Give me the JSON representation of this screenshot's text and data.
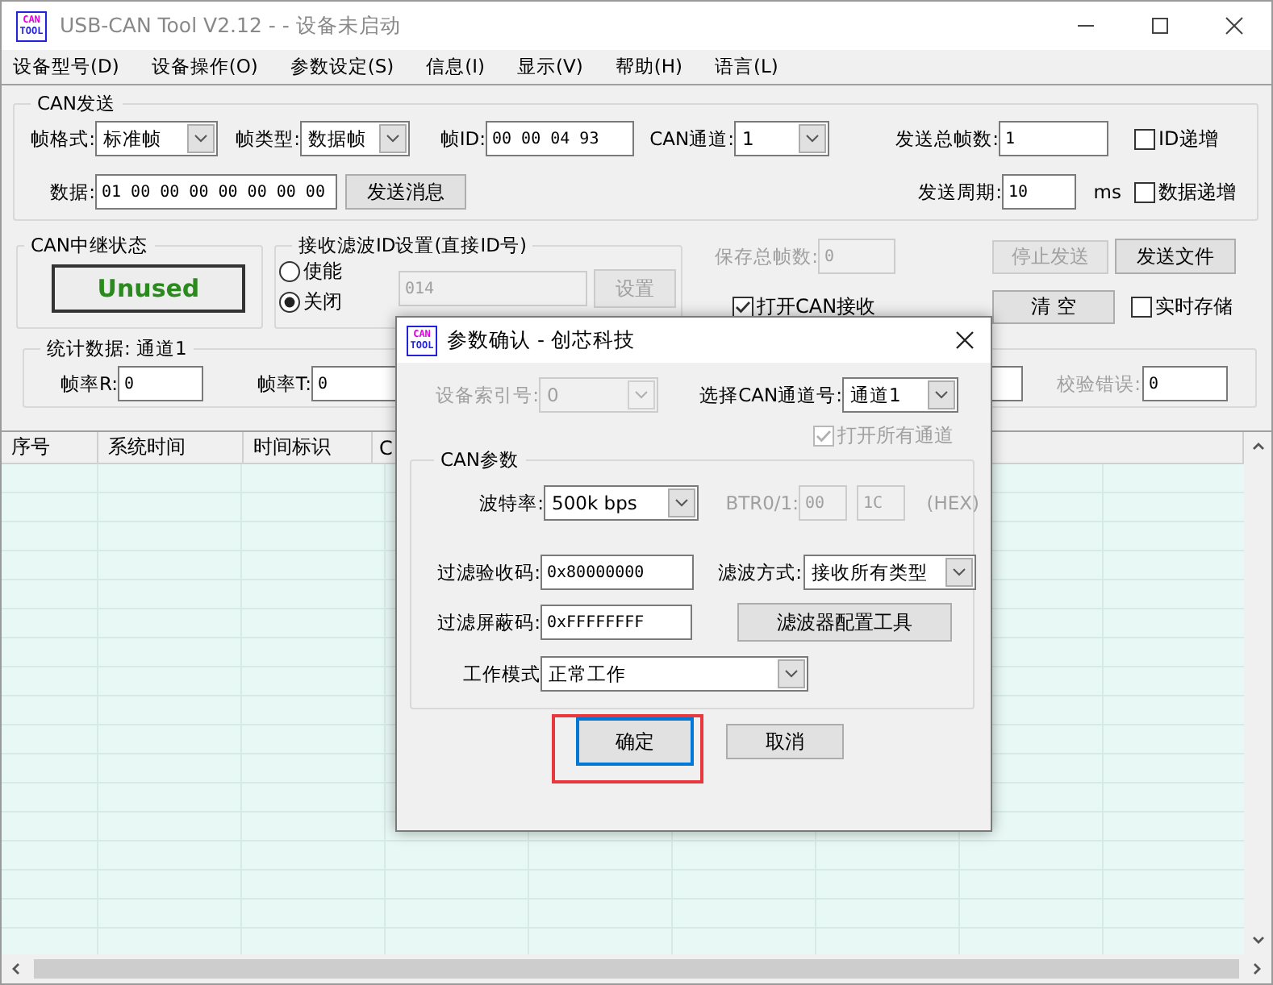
{
  "window": {
    "logo": [
      "CAN",
      "TOOL"
    ],
    "title": "USB-CAN Tool V2.12 -  - 设备未启动"
  },
  "menu": [
    "设备型号(D)",
    "设备操作(O)",
    "参数设定(S)",
    "信息(I)",
    "显示(V)",
    "帮助(H)",
    "语言(L)"
  ],
  "can_send": {
    "title": "CAN发送",
    "items": [
      {
        "kind": "label",
        "text": "帧格式:",
        "disabled": false
      },
      {
        "kind": "combo",
        "value": "标准帧",
        "disabled": false
      },
      {
        "kind": "label",
        "text": "帧类型:",
        "disabled": false
      },
      {
        "kind": "combo",
        "value": "数据帧",
        "disabled": false
      },
      {
        "kind": "label",
        "text": "帧ID:",
        "disabled": false
      },
      {
        "kind": "input",
        "value": "00 00 04 93",
        "disabled": false
      },
      {
        "kind": "label",
        "text": "CAN通道:",
        "disabled": false
      },
      {
        "kind": "combo",
        "value": "1",
        "disabled": false
      },
      {
        "kind": "label",
        "text": "发送总帧数:",
        "disabled": false
      },
      {
        "kind": "input",
        "value": "1",
        "disabled": false
      },
      {
        "kind": "check",
        "text": "ID递增",
        "checked": false,
        "disabled": false
      },
      {
        "kind": "label",
        "text": "数据:",
        "disabled": false
      },
      {
        "kind": "input",
        "value": "01 00 00 00 00 00 00 00",
        "disabled": false
      },
      {
        "kind": "button",
        "text": "发送消息",
        "disabled": false
      },
      {
        "kind": "label",
        "text": "发送周期:",
        "disabled": false
      },
      {
        "kind": "input",
        "value": "10",
        "disabled": false
      },
      {
        "kind": "label",
        "text": "ms",
        "disabled": false
      },
      {
        "kind": "check",
        "text": "数据递增",
        "checked": false,
        "disabled": false
      }
    ]
  },
  "relay": {
    "title": "CAN中继状态",
    "status": "Unused"
  },
  "filter": {
    "title": "接收滤波ID设置(直接ID号)",
    "options": [
      {
        "label": "使能",
        "selected": false
      },
      {
        "label": "关闭",
        "selected": true
      }
    ],
    "items": [
      {
        "kind": "input",
        "value": "014",
        "disabled": true
      },
      {
        "kind": "button",
        "text": "设置",
        "disabled": true
      }
    ]
  },
  "controls": {
    "items": [
      {
        "kind": "label",
        "text": "保存总帧数:",
        "disabled": true
      },
      {
        "kind": "input",
        "value": "0",
        "disabled": true
      },
      {
        "kind": "button",
        "text": "停止发送",
        "disabled": true
      },
      {
        "kind": "button",
        "text": "发送文件",
        "disabled": false
      },
      {
        "kind": "check",
        "text": "打开CAN接收",
        "checked": true,
        "disabled": false
      },
      {
        "kind": "button",
        "text": "清 空",
        "disabled": false
      },
      {
        "kind": "check",
        "text": "实时存储",
        "checked": false,
        "disabled": false
      }
    ]
  },
  "stats": {
    "title": "统计数据: 通道1",
    "items": [
      {
        "kind": "label",
        "text": "帧率R:",
        "disabled": false
      },
      {
        "kind": "input",
        "value": "0",
        "disabled": false
      },
      {
        "kind": "label",
        "text": "帧率T:",
        "disabled": false
      },
      {
        "kind": "input",
        "value": "0",
        "disabled": false
      },
      {
        "kind": "input",
        "disabled": false
      },
      {
        "kind": "label",
        "text": "校验错误:",
        "disabled": true
      },
      {
        "kind": "input",
        "value": "0",
        "disabled": false
      }
    ]
  },
  "table": {
    "columns": [
      "序号",
      "系统时间",
      "时间标识",
      "C"
    ]
  },
  "dialog": {
    "logo": [
      "CAN",
      "TOOL"
    ],
    "title": "参数确认 - 创芯科技",
    "items": [
      {
        "kind": "label",
        "text": "设备索引号:",
        "disabled": true
      },
      {
        "kind": "combo",
        "value": "0",
        "disabled": true
      },
      {
        "kind": "label",
        "text": "选择CAN通道号:",
        "disabled": false
      },
      {
        "kind": "combo",
        "value": "通道1",
        "disabled": false
      },
      {
        "kind": "check",
        "text": "打开所有通道",
        "checked": true,
        "disabled": true
      }
    ],
    "group": {
      "title": "CAN参数",
      "items": [
        {
          "kind": "label",
          "text": "波特率:",
          "disabled": false
        },
        {
          "kind": "combo",
          "value": "500k bps",
          "disabled": false
        },
        {
          "kind": "label",
          "text": "BTR0/1:",
          "disabled": true
        },
        {
          "kind": "input",
          "value": "00",
          "disabled": true
        },
        {
          "kind": "input",
          "value": "1C",
          "disabled": true
        },
        {
          "kind": "label",
          "text": "(HEX)",
          "disabled": true
        },
        {
          "kind": "label",
          "text": "过滤验收码:",
          "disabled": false
        },
        {
          "kind": "input",
          "value": "0x80000000",
          "disabled": false
        },
        {
          "kind": "label",
          "text": "滤波方式:",
          "disabled": false
        },
        {
          "kind": "combo",
          "value": "接收所有类型",
          "disabled": false
        },
        {
          "kind": "label",
          "text": "过滤屏蔽码:",
          "disabled": false
        },
        {
          "kind": "input",
          "value": "0xFFFFFFFF",
          "disabled": false
        },
        {
          "kind": "button",
          "text": "滤波器配置工具",
          "disabled": false
        },
        {
          "kind": "label",
          "text": "工作模式",
          "disabled": false
        },
        {
          "kind": "combo",
          "value": "正常工作",
          "disabled": false
        }
      ]
    },
    "buttons": [
      {
        "text": "确定",
        "default": true,
        "highlighted": true
      },
      {
        "text": "取消",
        "default": false,
        "highlighted": false
      }
    ]
  }
}
